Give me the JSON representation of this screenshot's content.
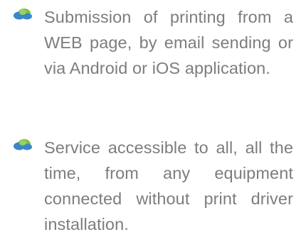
{
  "features": [
    {
      "icon": "cloud-icon",
      "text": "Submission of printing from a WEB page, by email sending or via Android or iOS application."
    },
    {
      "icon": "cloud-icon",
      "text": "Service accessible to all, all the time, from any equipment connected without print driver installation."
    }
  ],
  "colors": {
    "text": "#7d7d7d",
    "cloud_green": "#7cc242",
    "cloud_blue": "#3a86c8"
  }
}
